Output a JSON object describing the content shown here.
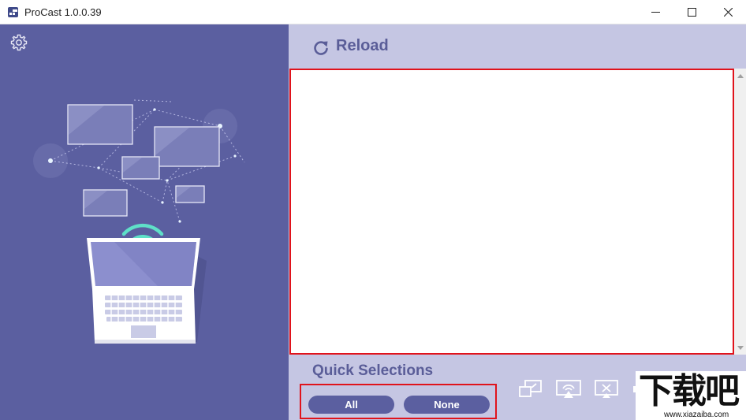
{
  "window": {
    "title": "ProCast 1.0.0.39"
  },
  "toolbar": {
    "reload_label": "Reload"
  },
  "quick_selections": {
    "title": "Quick Selections",
    "all_label": "All",
    "none_label": "None"
  },
  "icons": {
    "settings": "gear-icon",
    "reload": "reload-icon",
    "screen_mirror": "screen-mirror-icon",
    "airplay": "airplay-icon",
    "stop_cast": "stop-cast-icon",
    "volume": "volume-icon"
  },
  "watermark": {
    "logo": "下载吧",
    "url": "www.xiazaiba.com"
  },
  "colors": {
    "left_panel": "#5b5fa0",
    "right_panel": "#c5c6e3",
    "accent_text": "#5a5d98",
    "highlight_border": "#e0131c",
    "wifi": "#5fe0c8"
  }
}
